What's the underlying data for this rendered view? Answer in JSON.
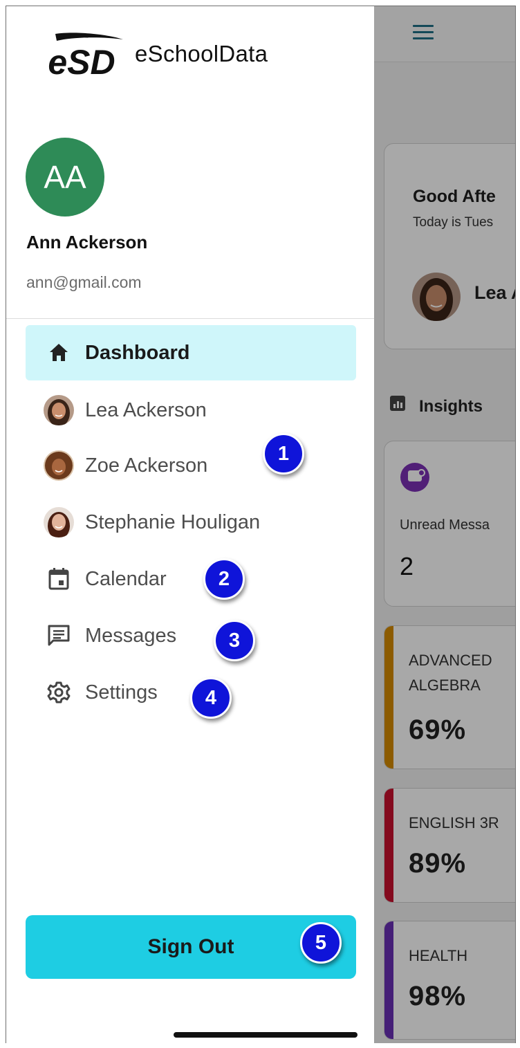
{
  "brand": {
    "logo_mark": "eSD",
    "name": "eSchoolData"
  },
  "profile": {
    "initials": "AA",
    "name": "Ann Ackerson",
    "email": "ann@gmail.com",
    "avatar_color": "#2e8b57"
  },
  "menu": {
    "items": [
      {
        "label": "Dashboard",
        "icon": "home-icon",
        "active": true
      },
      {
        "label": "Lea Ackerson",
        "icon": "student-photo"
      },
      {
        "label": "Zoe Ackerson",
        "icon": "student-photo"
      },
      {
        "label": "Stephanie Houligan",
        "icon": "student-photo"
      },
      {
        "label": "Calendar",
        "icon": "calendar-icon"
      },
      {
        "label": "Messages",
        "icon": "message-icon"
      },
      {
        "label": "Settings",
        "icon": "gear-icon"
      }
    ],
    "active_bg": "#cff6fa"
  },
  "sign_out": {
    "label": "Sign Out",
    "color": "#1ecde3"
  },
  "badges": [
    "1",
    "2",
    "3",
    "4",
    "5"
  ],
  "badge_color": "#0f14d9",
  "background": {
    "greeting": "Good Afte",
    "date_text": "Today is Tues",
    "student": "Lea A",
    "insights_label": "Insights",
    "unread_label": "Unread Messa",
    "unread_count": "2",
    "courses": [
      {
        "name": "ADVANCED ALGEBRA",
        "grade": "69%",
        "color": "#d58a00"
      },
      {
        "name": "ENGLISH 3R",
        "grade": "89%",
        "color": "#c8102e"
      },
      {
        "name": "HEALTH",
        "grade": "98%",
        "color": "#6a2fb5"
      }
    ]
  }
}
